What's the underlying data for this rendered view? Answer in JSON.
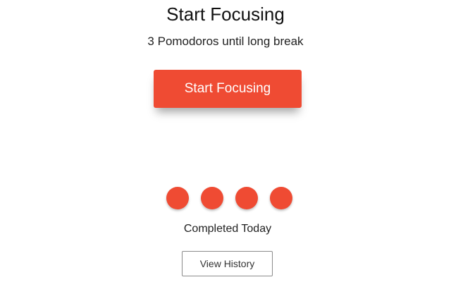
{
  "header": {
    "title": "Start Focusing",
    "subtitle": "3 Pomodoros until long break"
  },
  "actions": {
    "start_label": "Start Focusing",
    "history_label": "View History"
  },
  "progress": {
    "completed_today_count": 4,
    "completed_label": "Completed Today"
  },
  "colors": {
    "accent": "#ef4b33",
    "background": "#ffffff",
    "text": "#111111"
  }
}
